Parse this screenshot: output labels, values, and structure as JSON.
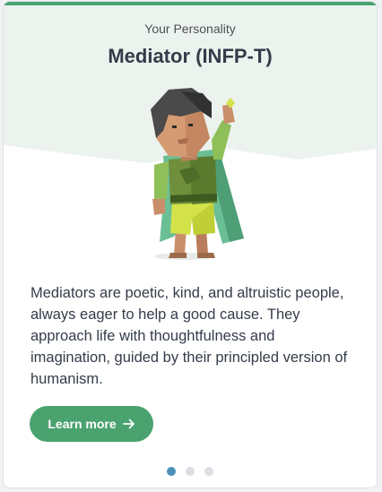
{
  "card": {
    "eyebrow": "Your Personality",
    "title": "Mediator (INFP-T)",
    "figure_icon": "mediator-character-illustration",
    "description": "Mediators are poetic, kind, and altruistic people, always eager to help a good cause. They approach life with thoughtfulness and imagination, guided by their principled version of humanism.",
    "button": {
      "label": "Learn more",
      "icon": "arrow-right-icon"
    }
  },
  "pagination": {
    "total": 3,
    "active_index": 0
  },
  "colors": {
    "accent": "#4aa26f",
    "hero_background": "#ecf3ee",
    "active_dot": "#4a90b8",
    "inactive_dot": "#dcdfe3",
    "text": "#343c4a"
  }
}
